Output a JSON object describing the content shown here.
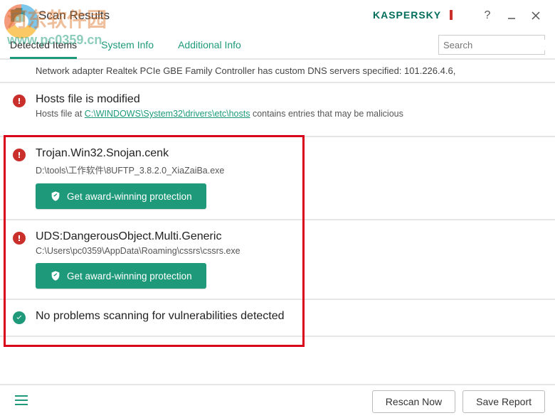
{
  "window": {
    "title": "Scan Results",
    "brand": "KASPERSKY",
    "help_tooltip": "?",
    "minimize_tooltip": "Minimize",
    "close_tooltip": "Close"
  },
  "tabs": {
    "items": [
      {
        "label": "Detected Items",
        "active": true
      },
      {
        "label": "System Info",
        "active": false
      },
      {
        "label": "Additional Info",
        "active": false
      }
    ]
  },
  "search": {
    "placeholder": "Search"
  },
  "items": [
    {
      "type": "info",
      "text": "Network adapter Realtek PCIe GBE Family Controller has custom DNS servers specified: 101.226.4.6,"
    },
    {
      "type": "alert",
      "title": "Hosts file is modified",
      "desc_prefix": "Hosts file at ",
      "desc_link": "C:\\WINDOWS\\System32\\drivers\\etc\\hosts",
      "desc_suffix": " contains entries that may be malicious"
    },
    {
      "type": "threat",
      "title": "Trojan.Win32.Snojan.cenk",
      "path": "D:\\tools\\工作软件\\8UFTP_3.8.2.0_XiaZaiBa.exe",
      "cta": "Get award-winning protection"
    },
    {
      "type": "threat",
      "title": "UDS:DangerousObject.Multi.Generic",
      "path": "C:\\Users\\pc0359\\AppData\\Roaming\\cssrs\\cssrs.exe",
      "cta": "Get award-winning protection"
    },
    {
      "type": "ok",
      "title": "No problems scanning for vulnerabilities detected"
    }
  ],
  "bottom": {
    "rescan": "Rescan Now",
    "save": "Save Report"
  },
  "watermark": {
    "line1": "河东软件园",
    "line2": "www.pc0359.cn"
  }
}
